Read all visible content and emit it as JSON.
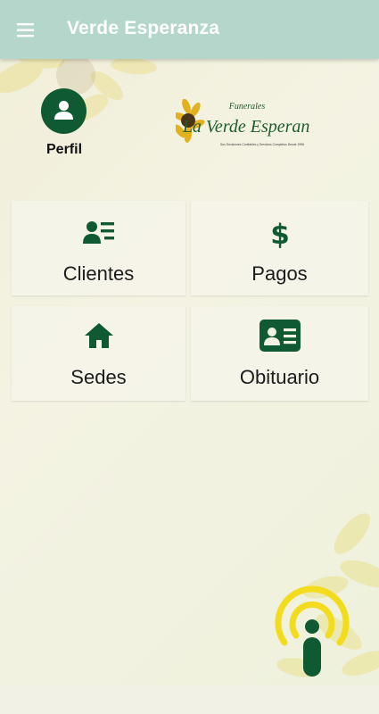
{
  "appbar": {
    "title": "Verde Esperanza",
    "menu_icon": "menu-icon"
  },
  "profile": {
    "label": "Perfil",
    "icon": "person-icon"
  },
  "logo": {
    "top_text": "Funerales",
    "main_text": "La Verde Esperanza",
    "tagline": "Sus Decisiones Confiables y Servicios Completos Desde 1996"
  },
  "tiles": [
    {
      "label": "Clientes",
      "icon": "client-list-icon"
    },
    {
      "label": "Pagos",
      "icon": "dollar-icon"
    },
    {
      "label": "Sedes",
      "icon": "home-icon"
    },
    {
      "label": "Obituario",
      "icon": "id-card-icon"
    }
  ],
  "fab": {
    "icon": "microphone-broadcast-icon"
  },
  "colors": {
    "appbar": "#b4d6cb",
    "primary_green": "#0f5a33",
    "accent_yellow": "#f3dc1d"
  }
}
